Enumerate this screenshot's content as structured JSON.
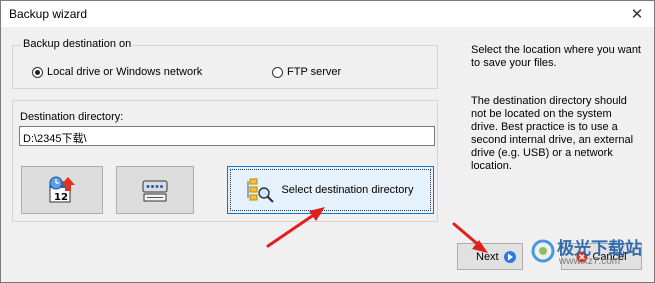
{
  "window": {
    "title": "Backup wizard",
    "close_glyph": "✕"
  },
  "destination_group": {
    "title": "Backup destination on",
    "options": [
      {
        "label": "Local drive or Windows network",
        "selected": true
      },
      {
        "label": "FTP server",
        "selected": false
      }
    ]
  },
  "directory_group": {
    "label": "Destination directory:",
    "value": "D:\\2345下载\\",
    "buttons": [
      {
        "icon": "calendar-schedule-icon"
      },
      {
        "icon": "network-drive-icon"
      },
      {
        "icon": "folder-search-icon",
        "label": "Select destination directory"
      }
    ]
  },
  "info": {
    "line1": "Select the location where you want to save your files.",
    "line2": "The destination directory should not be located on the system drive. Best practice is to use a second internal drive, an external drive (e.g. USB) or a network location."
  },
  "footer": {
    "next_label": "Next",
    "cancel_label": "Cancel"
  },
  "watermark": {
    "text": "极光下载站",
    "url": "www.xz7.com"
  },
  "colors": {
    "accent": "#0078d7",
    "arrow": "#e02020"
  }
}
